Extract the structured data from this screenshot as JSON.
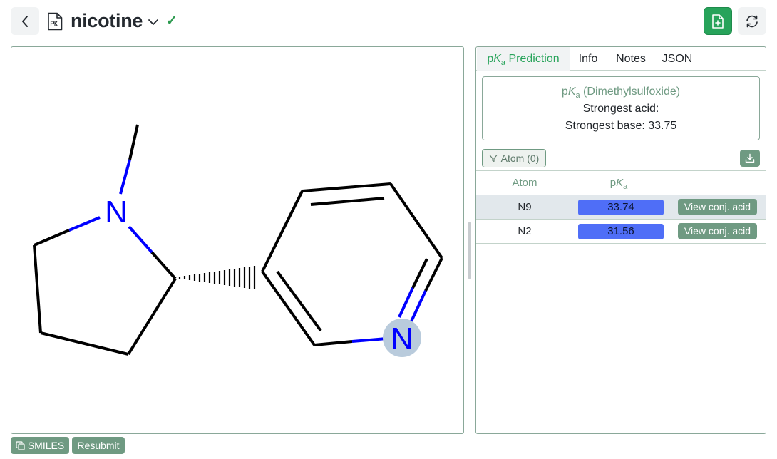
{
  "header": {
    "molecule_name": "nicotine",
    "validated_mark": "✓",
    "icons": {
      "back": "chevron-left-icon",
      "file": "file-icon",
      "dropdown": "chevron-down-icon",
      "save": "file-plus-icon",
      "refresh": "refresh-icon"
    },
    "colors": {
      "accent_green": "#27a35a"
    }
  },
  "molecule": {
    "atoms": [
      {
        "symbol": "N",
        "color": "#0000ff",
        "highlighted": false
      },
      {
        "symbol": "N",
        "color": "#0000ff",
        "highlighted": true,
        "highlight_color": "#b9cbdc"
      }
    ]
  },
  "tabs": [
    {
      "p": "p",
      "k": "K",
      "a": "a",
      "label": " Prediction",
      "active": true
    },
    {
      "label": "Info",
      "active": false
    },
    {
      "label": "Notes",
      "active": false
    },
    {
      "label": "JSON",
      "active": false
    }
  ],
  "summary": {
    "p": "p",
    "k": "K",
    "a": "a",
    "solvent_label": " (Dimethylsulfoxide)",
    "strongest_acid": "Strongest acid:",
    "strongest_base": "Strongest base: 33.75"
  },
  "filter": {
    "label": "Atom (0)",
    "icon": "filter-icon"
  },
  "download_icon": "download-icon",
  "table": {
    "headers": {
      "atom": "Atom",
      "pka_p": "p",
      "pka_k": "K",
      "pka_a": "a"
    },
    "rows": [
      {
        "atom": "N9",
        "pka": "33.74",
        "action": "View conj. acid",
        "selected": true,
        "bar_color": "#4f6ef7"
      },
      {
        "atom": "N2",
        "pka": "31.56",
        "action": "View conj. acid",
        "selected": false,
        "bar_color": "#4f6ef7"
      }
    ]
  },
  "bottom": {
    "smiles_label": "SMILES",
    "smiles_icon": "copy-icon",
    "resubmit_label": "Resubmit"
  }
}
